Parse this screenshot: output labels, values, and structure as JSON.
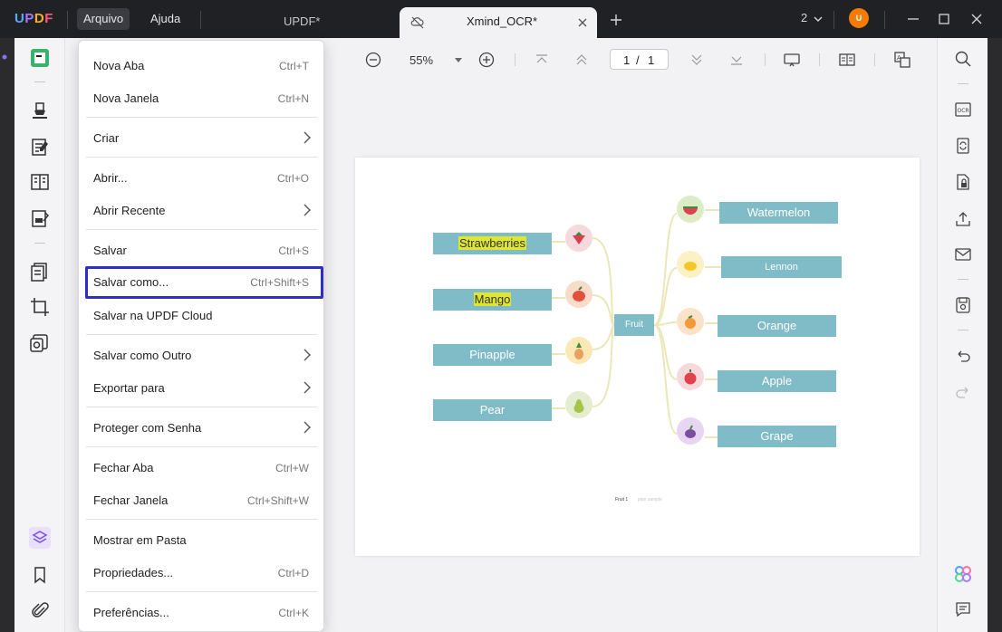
{
  "titlebar": {
    "logo": "UPDF",
    "menus": [
      "Arquivo",
      "Ajuda"
    ],
    "tabs": [
      {
        "title": "UPDF*"
      },
      {
        "title": "Xmind_OCR*"
      }
    ],
    "window_count": "2",
    "avatar_letter": "U"
  },
  "toolbar": {
    "zoom": "55%",
    "page_current": "1",
    "page_separator": "/",
    "page_total": "1"
  },
  "menu": {
    "items": [
      {
        "label": "Nova Aba",
        "shortcut": "Ctrl+T"
      },
      {
        "label": "Nova Janela",
        "shortcut": "Ctrl+N"
      },
      {
        "label": "Criar"
      },
      {
        "label": "Abrir...",
        "shortcut": "Ctrl+O"
      },
      {
        "label": "Abrir Recente"
      },
      {
        "label": "Salvar",
        "shortcut": "Ctrl+S"
      },
      {
        "label": "Salvar como...",
        "shortcut": "Ctrl+Shift+S"
      },
      {
        "label": "Salvar na UPDF Cloud"
      },
      {
        "label": "Salvar como Outro"
      },
      {
        "label": "Exportar para"
      },
      {
        "label": "Proteger com Senha"
      },
      {
        "label": "Fechar Aba",
        "shortcut": "Ctrl+W"
      },
      {
        "label": "Fechar Janela",
        "shortcut": "Ctrl+Shift+W"
      },
      {
        "label": "Mostrar em Pasta"
      },
      {
        "label": "Propriedades...",
        "shortcut": "Ctrl+D"
      },
      {
        "label": "Preferências...",
        "shortcut": "Ctrl+K"
      }
    ]
  },
  "document": {
    "center": "Fruit",
    "left_nodes": [
      "Strawberries",
      "Mango",
      "Pinapple",
      "Pear"
    ],
    "right_nodes": [
      "Watermelon",
      "Lennon",
      "Orange",
      "Apple",
      "Grape"
    ],
    "caption": "Fruit 1",
    "caption_faded": "plan sample"
  },
  "colors": {
    "accent_highlight_border": "#2d2fc4",
    "node_fill": "#7fbcc8",
    "text_highlight": "#dfe62f"
  }
}
